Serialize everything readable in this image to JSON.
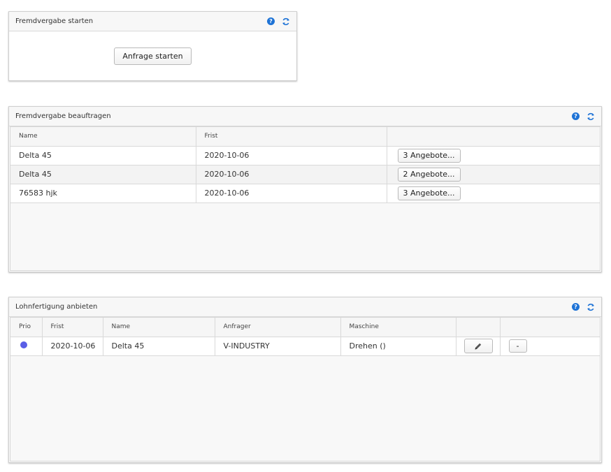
{
  "panel_start": {
    "title": "Fremdvergabe starten",
    "button_label": "Anfrage starten"
  },
  "panel_assign": {
    "title": "Fremdvergabe beauftragen",
    "columns": [
      "Name",
      "Frist",
      ""
    ],
    "rows": [
      {
        "name": "Delta 45",
        "frist": "2020-10-06",
        "offers_label": "3 Angebote..."
      },
      {
        "name": "Delta 45",
        "frist": "2020-10-06",
        "offers_label": "2 Angebote..."
      },
      {
        "name": "76583 hjk",
        "frist": "2020-10-06",
        "offers_label": "3 Angebote..."
      }
    ]
  },
  "panel_offer": {
    "title": "Lohnfertigung anbieten",
    "columns": [
      "Prio",
      "Frist",
      "Name",
      "Anfrager",
      "Maschine",
      "",
      ""
    ],
    "rows": [
      {
        "prio_color": "#5a5ee6",
        "frist": "2020-10-06",
        "name": "Delta 45",
        "anfrager": "V-INDUSTRY",
        "maschine": "Drehen ()",
        "minus_label": "-"
      }
    ]
  },
  "icons": {
    "help": "help-icon",
    "refresh": "refresh-icon",
    "edit": "pencil-icon"
  },
  "colors": {
    "accent": "#1e73d6",
    "prio": "#5a5ee6"
  }
}
